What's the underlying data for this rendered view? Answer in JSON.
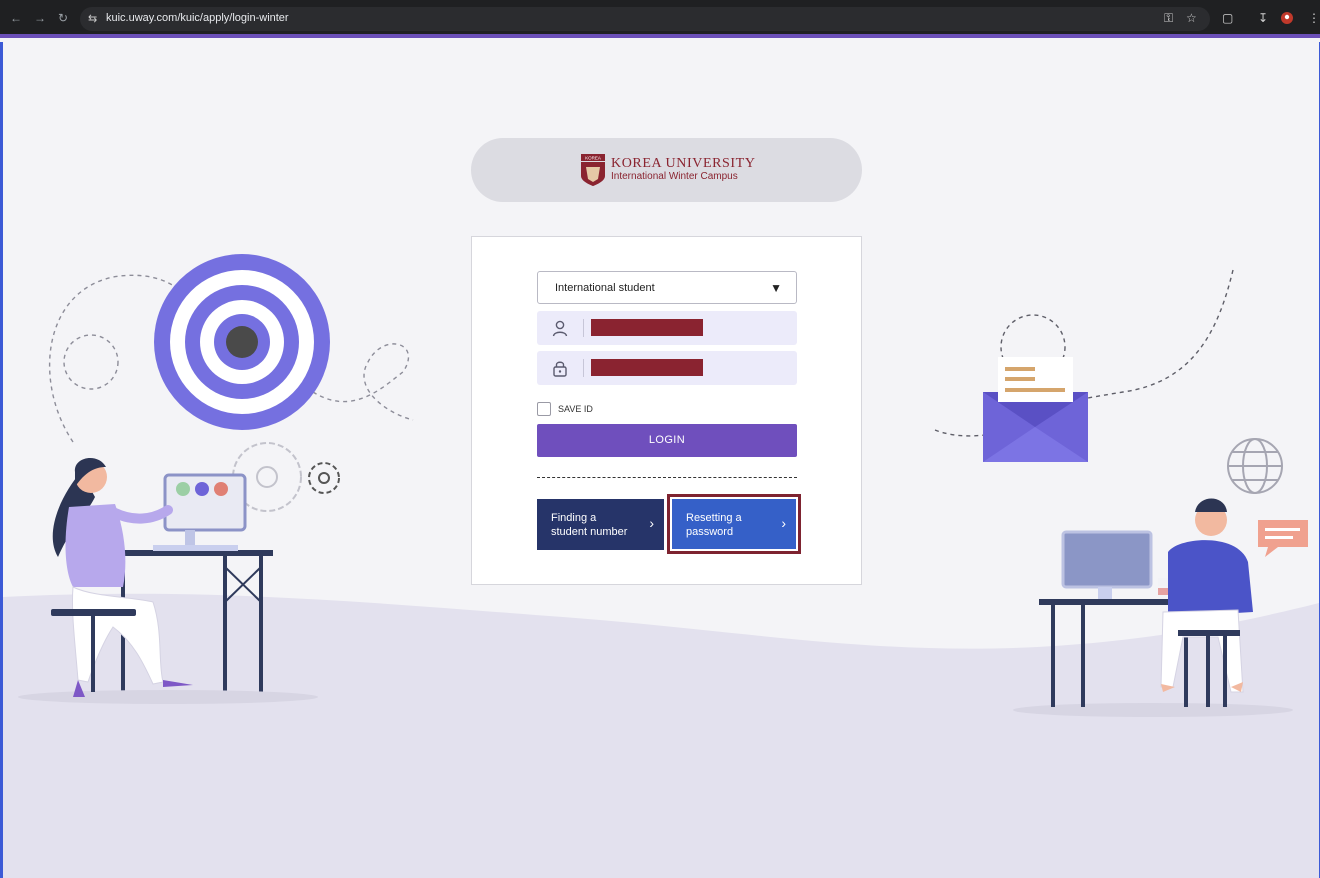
{
  "browser": {
    "url": "kuic.uway.com/kuic/apply/login-winter"
  },
  "logo": {
    "name": "KOREA UNIVERSITY",
    "subtitle": "International Winter Campus",
    "crest_text": "KOREA",
    "brand_color": "#8a2430"
  },
  "login": {
    "student_type_selected": "International student",
    "id_value": "",
    "password_value": "",
    "save_id_label": "SAVE ID",
    "save_id_checked": false,
    "login_label": "LOGIN",
    "login_color": "#6f4fbd"
  },
  "links": {
    "find_student_number": "Finding a\nstudent number",
    "reset_password": "Resetting a\npassword"
  },
  "icons": {
    "back": "arrow-left-icon",
    "forward": "arrow-right-icon",
    "reload": "reload-icon",
    "site_info": "tune-icon",
    "password_key": "key-icon",
    "bookmark": "star-icon",
    "extensions": "puzzle-icon",
    "download": "download-icon",
    "profile": "profile-icon",
    "menu": "kebab-menu-icon",
    "user": "user-icon",
    "lock": "lock-icon",
    "chevron": "chevron-right-icon"
  }
}
